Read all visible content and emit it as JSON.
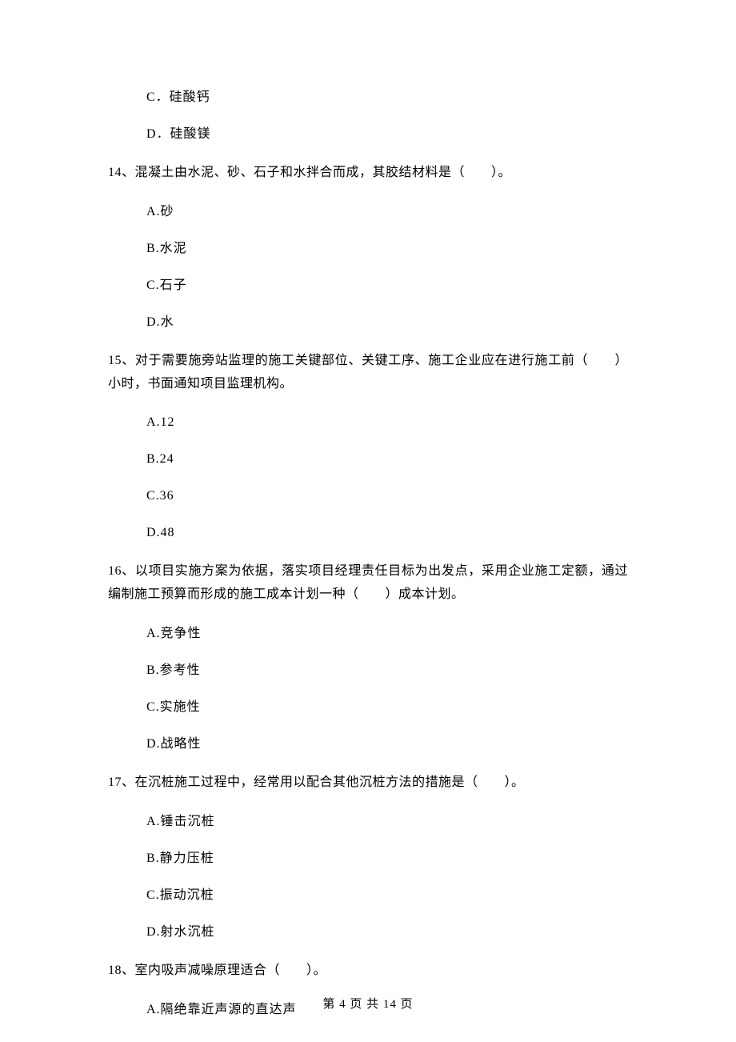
{
  "q13": {
    "optC": "C．硅酸钙",
    "optD": "D．硅酸镁"
  },
  "q14": {
    "text": "14、混凝土由水泥、砂、石子和水拌合而成，其胶结材料是（　　）。",
    "optA": "A.砂",
    "optB": "B.水泥",
    "optC": "C.石子",
    "optD": "D.水"
  },
  "q15": {
    "text": "15、对于需要施旁站监理的施工关键部位、关键工序、施工企业应在进行施工前（　　）小时，书面通知项目监理机构。",
    "optA": "A.12",
    "optB": "B.24",
    "optC": "C.36",
    "optD": "D.48"
  },
  "q16": {
    "text": "16、以项目实施方案为依据，落实项目经理责任目标为出发点，采用企业施工定额，通过编制施工预算而形成的施工成本计划一种（　　）成本计划。",
    "optA": "A.竞争性",
    "optB": "B.参考性",
    "optC": "C.实施性",
    "optD": "D.战略性"
  },
  "q17": {
    "text": "17、在沉桩施工过程中，经常用以配合其他沉桩方法的措施是（　　）。",
    "optA": "A.锤击沉桩",
    "optB": "B.静力压桩",
    "optC": "C.振动沉桩",
    "optD": "D.射水沉桩"
  },
  "q18": {
    "text": "18、室内吸声减噪原理适合（　　）。",
    "optA": "A.隔绝靠近声源的直达声"
  },
  "footer": "第 4 页 共 14 页"
}
